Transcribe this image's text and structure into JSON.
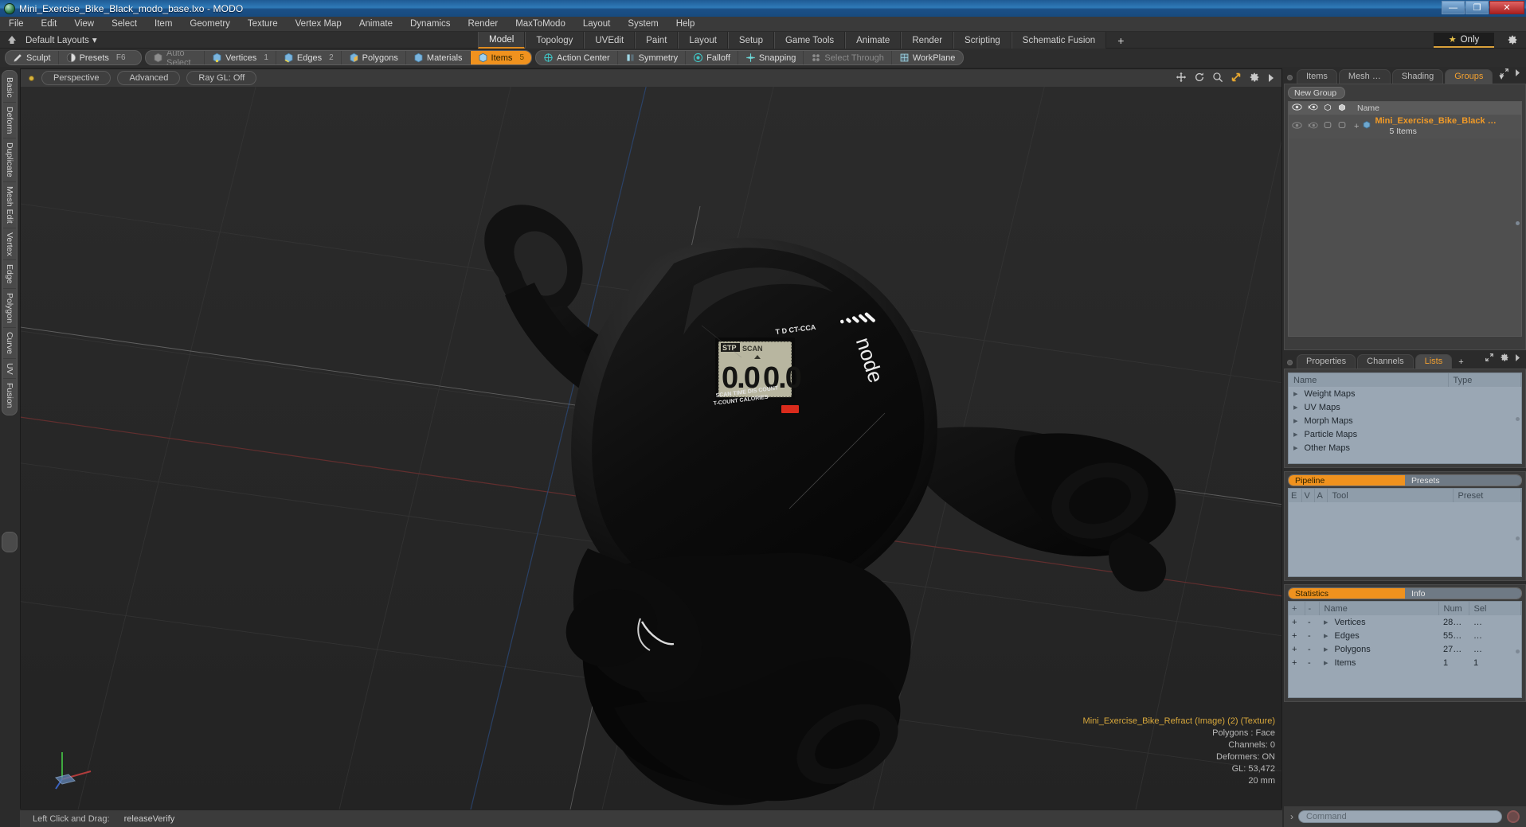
{
  "window": {
    "title": "Mini_Exercise_Bike_Black_modo_base.lxo - MODO",
    "app_icon": "modo-logo-icon",
    "minimize": "—",
    "maximize": "❐",
    "close": "✕"
  },
  "menu": {
    "items": [
      "File",
      "Edit",
      "View",
      "Select",
      "Item",
      "Geometry",
      "Texture",
      "Vertex Map",
      "Animate",
      "Dynamics",
      "Render",
      "MaxToModo",
      "Layout",
      "System",
      "Help"
    ]
  },
  "layout_bar": {
    "home_icon": "home-icon",
    "default_layouts": "Default Layouts",
    "dropdown_caret": "▾",
    "tabs": [
      {
        "label": "Model",
        "active": true
      },
      {
        "label": "Topology",
        "active": false
      },
      {
        "label": "UVEdit",
        "active": false
      },
      {
        "label": "Paint",
        "active": false
      },
      {
        "label": "Layout",
        "active": false
      },
      {
        "label": "Setup",
        "active": false
      },
      {
        "label": "Game Tools",
        "active": false
      },
      {
        "label": "Animate",
        "active": false
      },
      {
        "label": "Render",
        "active": false
      },
      {
        "label": "Scripting",
        "active": false
      },
      {
        "label": "Schematic Fusion",
        "active": false
      }
    ],
    "add_tab": "+",
    "only_button": "Only",
    "star_icon": "star-icon",
    "gear_icon": "gear-icon"
  },
  "toolbar": {
    "group1": [
      {
        "label": "Sculpt",
        "icon": "pencil-icon",
        "shortcut": "",
        "state": "normal"
      },
      {
        "label": "Presets",
        "icon": "sphere-icon",
        "shortcut": "F6",
        "state": "normal"
      }
    ],
    "group2": [
      {
        "label": "Auto Select",
        "icon": "cube-gray-icon",
        "shortcut": "",
        "state": "disabled"
      },
      {
        "label": "Vertices",
        "icon": "cube-vertex-icon",
        "shortcut": "1",
        "state": "normal"
      },
      {
        "label": "Edges",
        "icon": "cube-edge-icon",
        "shortcut": "2",
        "state": "normal"
      },
      {
        "label": "Polygons",
        "icon": "cube-poly-icon",
        "shortcut": "",
        "state": "normal"
      },
      {
        "label": "Materials",
        "icon": "cube-material-icon",
        "shortcut": "",
        "state": "normal"
      },
      {
        "label": "Items",
        "icon": "cube-items-icon",
        "shortcut": "5",
        "state": "selected"
      }
    ],
    "group3": [
      {
        "label": "Action Center",
        "icon": "crosshair-icon",
        "state": "normal"
      },
      {
        "label": "Symmetry",
        "icon": "symmetry-icon",
        "state": "normal"
      },
      {
        "label": "Falloff",
        "icon": "falloff-icon",
        "state": "normal"
      },
      {
        "label": "Snapping",
        "icon": "snapping-icon",
        "state": "normal"
      },
      {
        "label": "Select Through",
        "icon": "select-through-icon",
        "state": "disabled"
      },
      {
        "label": "WorkPlane",
        "icon": "workplane-icon",
        "state": "normal"
      }
    ]
  },
  "left_tabs": [
    "Basic",
    "Deform",
    "Duplicate",
    "Mesh Edit",
    "Vertex",
    "Edge",
    "Polygon",
    "Curve",
    "UV",
    "Fusion"
  ],
  "viewport": {
    "indicator_dot": "active-viewport-dot",
    "buttons": [
      "Perspective",
      "Advanced",
      "Ray GL: Off"
    ],
    "icons": [
      "move-icon",
      "rotate-icon",
      "zoom-icon",
      "fit-icon",
      "gear-icon",
      "more-icon"
    ],
    "stats": {
      "name": "Mini_Exercise_Bike_Refract (Image) (2) (Texture)",
      "polygons": "Polygons : Face",
      "channels": "Channels: 0",
      "deformers": "Deformers: ON",
      "gl": "GL: 53,472",
      "scale": "20 mm"
    },
    "model": {
      "lcd_stp": "STP",
      "lcd_scan": "SCAN",
      "lcd_value_left": "0.0",
      "lcd_value_right": "0.0",
      "lcd_labels_top": "SCAN TIME DIS  COUNT",
      "lcd_labels_bottom": "T-COUNT CALORIES",
      "brand_text": "node",
      "top_marks": "T D CT-CCA"
    }
  },
  "status_bar": {
    "hint_label": "Left Click and Drag:",
    "hint_value": "releaseVerify"
  },
  "right_panel": {
    "top": {
      "tabs": [
        {
          "label": "Items",
          "active": false
        },
        {
          "label": "Mesh …",
          "active": false
        },
        {
          "label": "Shading",
          "active": false
        },
        {
          "label": "Groups",
          "active": true
        }
      ],
      "caret": "▾",
      "expand_icon": "expand-icon",
      "more_icon": "more-arrow-icon",
      "new_group_button": "New Group",
      "col_icons": [
        "eye-icon",
        "render-icon",
        "lock-icon",
        "wire-icon"
      ],
      "name_header": "Name",
      "rows": [
        {
          "name": "Mini_Exercise_Bike_Black …",
          "sub": "5 Items",
          "expand": "+",
          "icon": "group-icon"
        }
      ]
    },
    "middle": {
      "tabs": [
        {
          "label": "Properties",
          "active": false
        },
        {
          "label": "Channels",
          "active": false
        },
        {
          "label": "Lists",
          "active": true
        }
      ],
      "add_tab": "+",
      "expand_icon": "expand-icon",
      "gear_icon": "gear-icon",
      "more_icon": "more-arrow-icon",
      "columns": [
        "Name",
        "Type"
      ],
      "rows": [
        {
          "name": "Weight Maps",
          "type": ""
        },
        {
          "name": "UV Maps",
          "type": ""
        },
        {
          "name": "Morph Maps",
          "type": ""
        },
        {
          "name": "Particle Maps",
          "type": ""
        },
        {
          "name": "Other Maps",
          "type": ""
        }
      ]
    },
    "pipeline": {
      "tabs": [
        {
          "label": "Pipeline",
          "active": true
        },
        {
          "label": "Presets",
          "active": false
        }
      ],
      "columns": [
        "E",
        "V",
        "A",
        "Tool",
        "Preset"
      ],
      "rows": []
    },
    "statistics": {
      "tabs": [
        {
          "label": "Statistics",
          "active": true
        },
        {
          "label": "Info",
          "active": false
        }
      ],
      "columns": [
        "+",
        "-",
        "Name",
        "Num",
        "Sel"
      ],
      "rows": [
        {
          "plus": "+",
          "minus": "-",
          "name": "Vertices",
          "num": "28…",
          "sel": "…"
        },
        {
          "plus": "+",
          "minus": "-",
          "name": "Edges",
          "num": "55…",
          "sel": "…"
        },
        {
          "plus": "+",
          "minus": "-",
          "name": "Polygons",
          "num": "27…",
          "sel": "…"
        },
        {
          "plus": "+",
          "minus": "-",
          "name": "Items",
          "num": "1",
          "sel": "1"
        }
      ]
    },
    "command": {
      "chevron": "›",
      "placeholder": "Command",
      "record_icon": "record-icon"
    }
  },
  "colors": {
    "accent_orange": "#f0921e",
    "panel_bg": "#3c3c3c",
    "list_bg": "#9aa7b4",
    "viewport_bg": "#262626",
    "title_blue": "#2f7ab8"
  }
}
